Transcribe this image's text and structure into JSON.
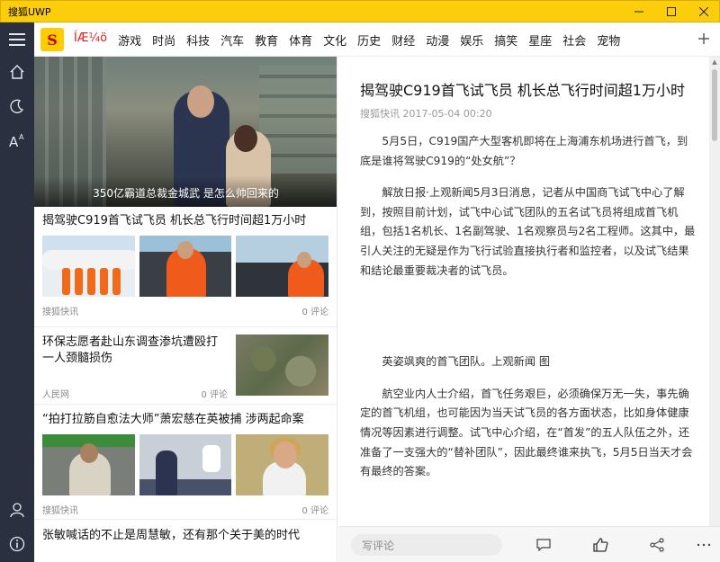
{
  "window": {
    "title": "搜狐UWP"
  },
  "channels": {
    "items": [
      "ÍÆ¼ö",
      "游戏",
      "时尚",
      "科技",
      "汽车",
      "教育",
      "体育",
      "文化",
      "历史",
      "财经",
      "动漫",
      "娱乐",
      "搞笑",
      "星座",
      "社会",
      "宠物"
    ],
    "active": 0
  },
  "feed": {
    "hero_caption": "350亿霸道总裁金城武 是怎么帅回来的",
    "items": [
      {
        "title": "揭驾驶C919首飞试飞员 机长总飞行时间超1万小时",
        "source": "搜狐快讯",
        "comments": "0 评论"
      },
      {
        "title": "环保志愿者赴山东调查渗坑遭殴打 一人颈髓损伤",
        "source": "人民网",
        "comments": "0 评论"
      },
      {
        "title": "“拍打拉筋自愈法大师”萧宏慈在英被捕 涉两起命案",
        "source": "搜狐快讯",
        "comments": "0 评论"
      },
      {
        "title": "张敏喊话的不止是周慧敏，还有那个关于美的时代"
      }
    ]
  },
  "article": {
    "title": "揭驾驶C919首飞试飞员 机长总飞行时间超1万小时",
    "meta": "搜狐快讯 2017-05-04 00:20",
    "paragraphs": [
      "5月5日，C919国产大型客机即将在上海浦东机场进行首飞，到底是谁将驾驶C919的“处女航”？",
      "解放日报·上观新闻5月3日消息，记者从中国商飞试飞中心了解到，按照目前计划，试飞中心试飞团队的五名试飞员将组成首飞机组，包括1名机长、1名副驾驶、1名观察员与2名工程师。这其中，最引人关注的无疑是作为飞行试验直接执行者和监控者，以及试飞结果和结论最重要裁决者的试飞员。",
      "英姿飒爽的首飞团队。上观新闻 图",
      "航空业内人士介绍，首飞任务艰巨，必须确保万无一失，事先确定的首飞机组，也可能因为当天试飞员的各方面状态，比如身体健康情况等因素进行调整。试飞中心介绍，在“首发”的五人队伍之外，还准备了一支强大的“替补团队”，因此最终谁来执飞，5月5日当天才会有最终的答案。"
    ]
  },
  "comment_bar": {
    "placeholder": "写评论"
  },
  "colors": {
    "titlebar": "#fbcd0b",
    "rail": "#2b3040",
    "accent": "#e61c1c"
  }
}
